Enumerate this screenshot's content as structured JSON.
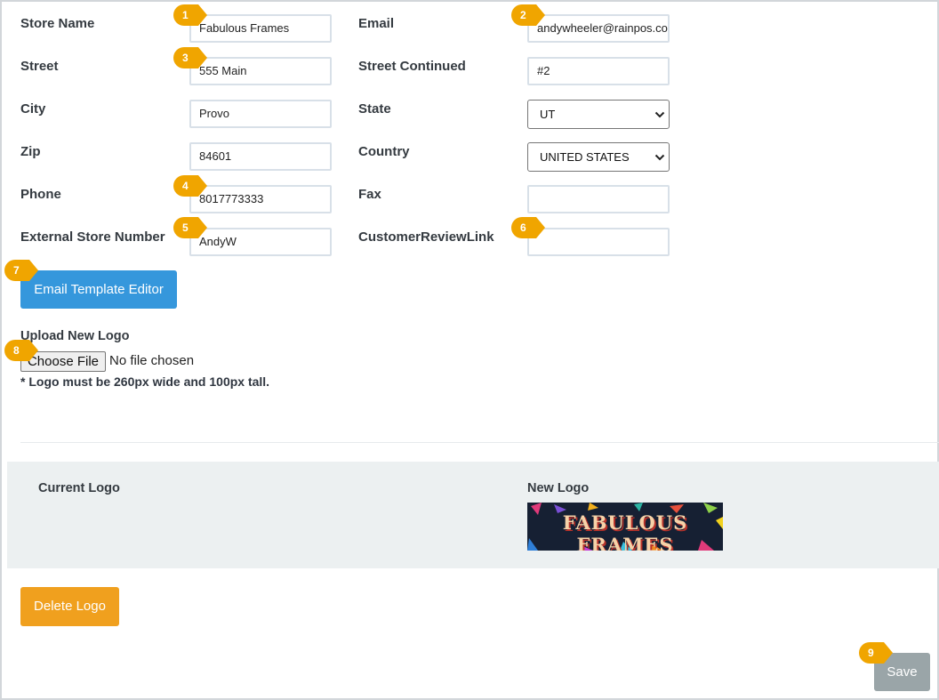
{
  "form": {
    "store_name": {
      "label": "Store Name",
      "value": "Fabulous Frames"
    },
    "email": {
      "label": "Email",
      "value": "andywheeler@rainpos.co"
    },
    "street": {
      "label": "Street",
      "value": "555 Main"
    },
    "street_continued": {
      "label": "Street Continued",
      "value": "#2"
    },
    "city": {
      "label": "City",
      "value": "Provo"
    },
    "state": {
      "label": "State",
      "value": "UT"
    },
    "zip": {
      "label": "Zip",
      "value": "84601"
    },
    "country": {
      "label": "Country",
      "value": "UNITED STATES"
    },
    "phone": {
      "label": "Phone",
      "value": "8017773333"
    },
    "fax": {
      "label": "Fax",
      "value": ""
    },
    "external_store_number": {
      "label": "External Store Number",
      "value": "AndyW"
    },
    "customer_review_link": {
      "label": "CustomerReviewLink",
      "value": ""
    }
  },
  "email_template_button": "Email Template Editor",
  "upload": {
    "label": "Upload New Logo",
    "choose_file": "Choose File",
    "no_file": "No file chosen",
    "note": "* Logo must be 260px wide and 100px tall."
  },
  "logos": {
    "current_label": "Current Logo",
    "new_label": "New Logo",
    "new_logo_text": "FABULOUS FRAMES"
  },
  "delete_logo_button": "Delete Logo",
  "save_button": "Save",
  "callouts": [
    "1",
    "2",
    "3",
    "4",
    "5",
    "6",
    "7",
    "8",
    "9"
  ],
  "colors": {
    "callout": "#f0a500",
    "primary_button": "#3597dc",
    "delete_button": "#f0a01e",
    "save_button": "#9aa5a8",
    "logo_panel": "#ecf0f1"
  },
  "icons": {
    "select_arrow": "chevron-down-icon"
  }
}
